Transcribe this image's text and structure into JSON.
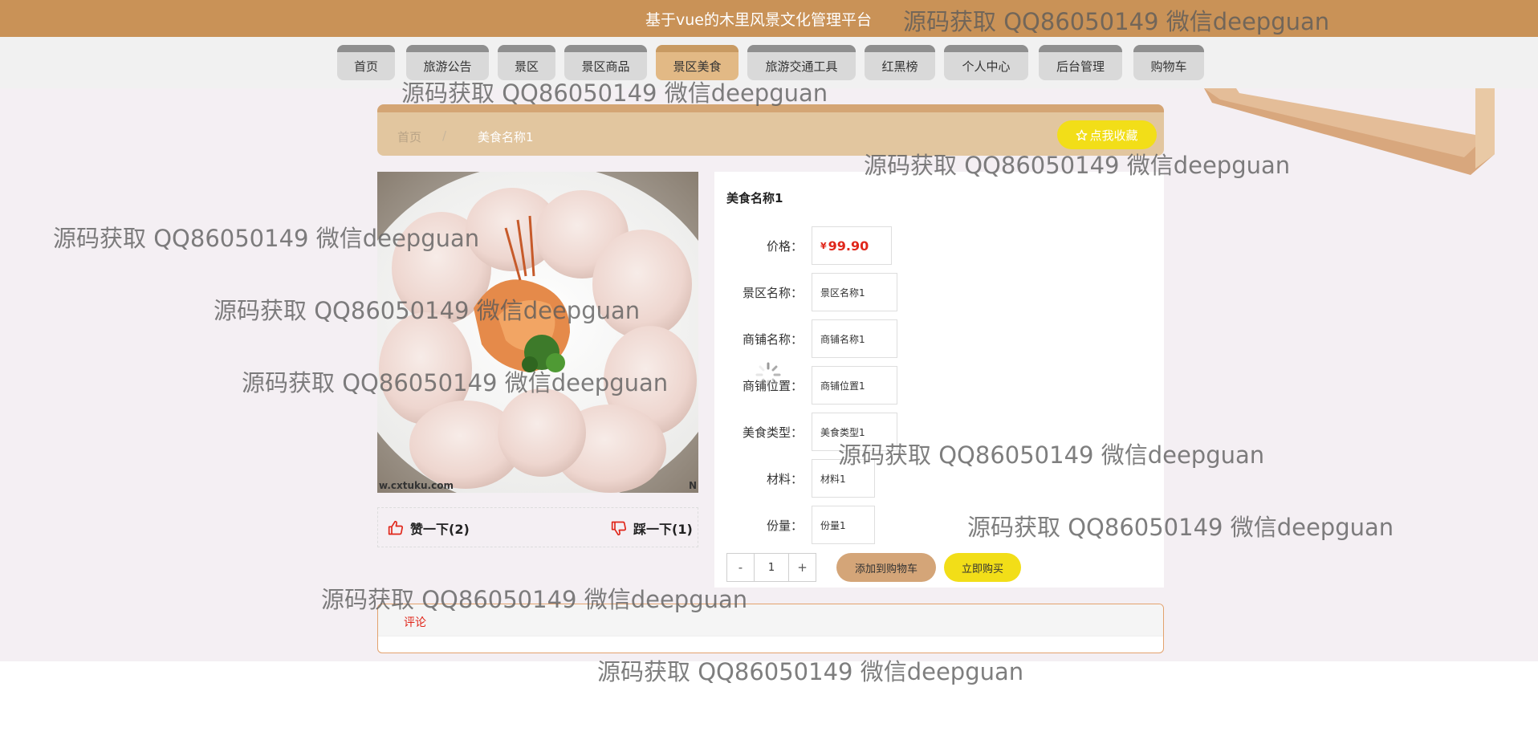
{
  "header": {
    "title": "基于vue的木里风景文化管理平台"
  },
  "nav": {
    "items": [
      {
        "label": "首页"
      },
      {
        "label": "旅游公告"
      },
      {
        "label": "景区"
      },
      {
        "label": "景区商品"
      },
      {
        "label": "景区美食",
        "active": true
      },
      {
        "label": "旅游交通工具"
      },
      {
        "label": "红黑榜"
      },
      {
        "label": "个人中心"
      },
      {
        "label": "后台管理"
      },
      {
        "label": "购物车"
      }
    ]
  },
  "breadcrumb": {
    "home": "首页",
    "separator": "/",
    "current": "美食名称1"
  },
  "collect_button": {
    "icon": "star-outline-icon",
    "label": "点我收藏"
  },
  "image": {
    "watermark_left": "w.cxtuku.com",
    "watermark_right": "N"
  },
  "votes": {
    "like_label": "赞一下(2)",
    "like_icon": "thumbs-up-icon",
    "dislike_label": "踩一下(1)",
    "dislike_icon": "thumbs-down-icon"
  },
  "detail": {
    "name": "美食名称1",
    "fields": [
      {
        "label": "价格：",
        "currency": "¥",
        "value": "99.90"
      },
      {
        "label": "景区名称：",
        "value": "景区名称1"
      },
      {
        "label": "商铺名称：",
        "value": "商铺名称1"
      },
      {
        "label": "商铺位置：",
        "value": "商铺位置1"
      },
      {
        "label": "美食类型：",
        "value": "美食类型1"
      },
      {
        "label": "材料：",
        "value": "材料1"
      },
      {
        "label": "份量：",
        "value": "份量1"
      }
    ],
    "quantity": {
      "minus": "-",
      "value": "1",
      "plus": "+"
    },
    "add_to_cart": "添加到购物车",
    "buy_now": "立即购买"
  },
  "comments": {
    "tab_label": "评论"
  },
  "watermark": {
    "text": "源码获取 QQ86050149 微信deepguan"
  },
  "colors": {
    "header": "#c99257",
    "accent": "#e2b985",
    "button_yellow": "#f2de18",
    "price": "#e0261a"
  }
}
